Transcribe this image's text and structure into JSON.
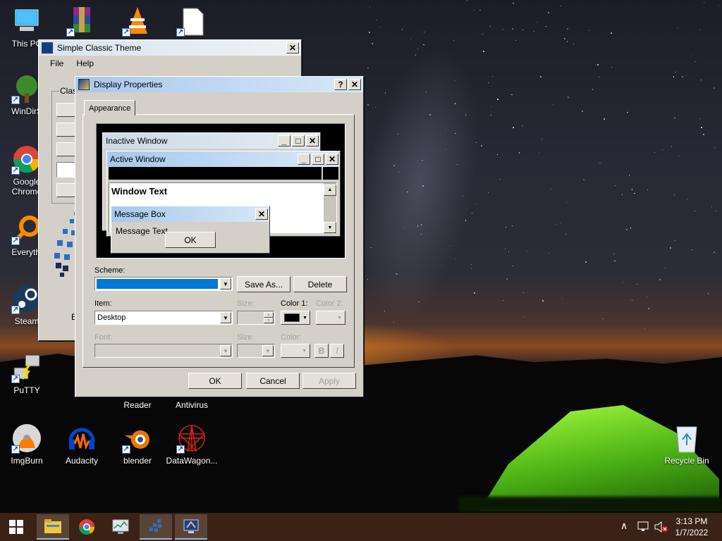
{
  "desktop": {
    "icons": [
      {
        "label": "This PC",
        "icon": "computer-icon"
      },
      {
        "label": "WinDirS",
        "icon": "tree-icon"
      },
      {
        "label": "Google Chrome",
        "icon": "chrome-icon"
      },
      {
        "label": "Everythi",
        "icon": "magnifier-icon"
      },
      {
        "label": "Steam",
        "icon": "steam-icon"
      },
      {
        "label": "PuTTY",
        "icon": "putty-icon"
      },
      {
        "label": "ImgBurn",
        "icon": "disc-burn-icon"
      },
      {
        "label": "Audacity",
        "icon": "audacity-icon"
      },
      {
        "label": "blender",
        "icon": "blender-icon"
      },
      {
        "label": "DataWagon...",
        "icon": "datawagon-icon"
      },
      {
        "label": "Reader",
        "icon": "reader-icon"
      },
      {
        "label": "Antivirus",
        "icon": "antivirus-icon"
      },
      {
        "label": "Recycle Bin",
        "icon": "recycle-bin-icon"
      }
    ]
  },
  "back_window": {
    "title": "Simple Classic Theme",
    "menu": [
      "File",
      "Help"
    ],
    "group_label": "Clas",
    "partial_label": "E"
  },
  "dialog": {
    "title": "Display Properties",
    "tab": "Appearance",
    "preview": {
      "inactive": "Inactive Window",
      "active": "Active Window",
      "window_text": "Window Text",
      "msgbox_title": "Message Box",
      "msgbox_text": "Message Text",
      "msgbox_ok": "OK"
    },
    "scheme_label": "Scheme:",
    "scheme_value": "",
    "save_as": "Save As...",
    "delete": "Delete",
    "item_label": "Item:",
    "item_value": "Desktop",
    "size_label": "Size:",
    "color1_label": "Color 1:",
    "color2_label": "Color 2:",
    "font_label": "Font:",
    "font_size_label": "Size:",
    "font_color_label": "Color:",
    "bold": "B",
    "italic": "I",
    "ok": "OK",
    "cancel": "Cancel",
    "apply": "Apply"
  },
  "colors": {
    "scheme_highlight": "#0078d7",
    "color1": "#000000"
  },
  "taskbar": {
    "time": "3:13 PM",
    "date": "1/7/2022"
  }
}
